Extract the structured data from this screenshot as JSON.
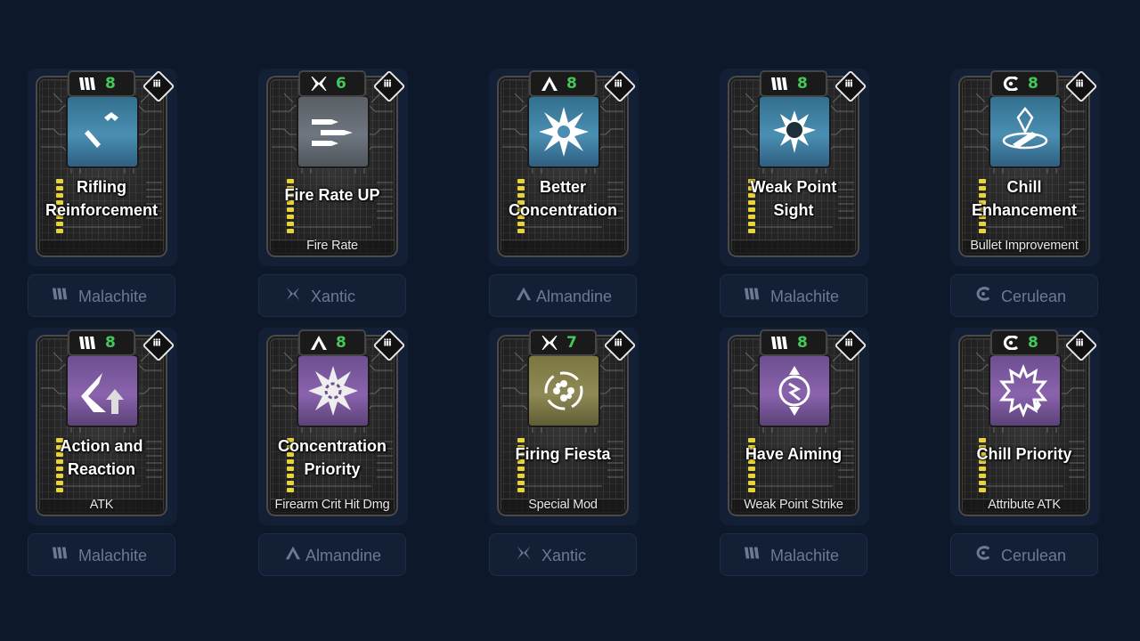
{
  "cards": [
    {
      "cost": "8",
      "family_icon": "malachite-icon",
      "art": "blue",
      "art_icon": "rifling-icon",
      "name": [
        "Rifling",
        "Reinforcement"
      ],
      "subtitle": "",
      "tag": "Malachite"
    },
    {
      "cost": "6",
      "family_icon": "xantic-icon",
      "art": "gray",
      "art_icon": "bullets-icon",
      "name": [
        "Fire Rate UP"
      ],
      "subtitle": "Fire Rate",
      "tag": "Xantic"
    },
    {
      "cost": "8",
      "family_icon": "almandine-icon",
      "art": "blue",
      "art_icon": "burst-star-icon",
      "name": [
        "Better",
        "Concentration"
      ],
      "subtitle": "",
      "tag": "Almandine"
    },
    {
      "cost": "8",
      "family_icon": "malachite-icon",
      "art": "blue",
      "art_icon": "weak-point-icon",
      "name": [
        "Weak Point",
        "Sight"
      ],
      "subtitle": "",
      "tag": "Malachite"
    },
    {
      "cost": "8",
      "family_icon": "cerulean-icon",
      "art": "blue",
      "art_icon": "chill-bullet-icon",
      "name": [
        "Chill",
        "Enhancement"
      ],
      "subtitle": "Bullet Improvement",
      "tag": "Cerulean"
    },
    {
      "cost": "8",
      "family_icon": "malachite-icon",
      "art": "purple",
      "art_icon": "arrow-up-icon",
      "name": [
        "Action and",
        "Reaction"
      ],
      "subtitle": "ATK",
      "tag": "Malachite"
    },
    {
      "cost": "8",
      "family_icon": "almandine-icon",
      "art": "purple",
      "art_icon": "crit-star-icon",
      "name": [
        "Concentration",
        "Priority"
      ],
      "subtitle": "Firearm Crit Hit Dmg",
      "tag": "Almandine"
    },
    {
      "cost": "7",
      "family_icon": "xantic-icon",
      "art": "gold",
      "art_icon": "revolver-cylinder-icon",
      "name": [
        "Firing Fiesta"
      ],
      "subtitle": "Special Mod",
      "tag": "Xantic"
    },
    {
      "cost": "8",
      "family_icon": "malachite-icon",
      "art": "purple",
      "art_icon": "aiming-icon",
      "name": [
        "Have Aiming"
      ],
      "subtitle": "Weak Point Strike",
      "tag": "Malachite"
    },
    {
      "cost": "8",
      "family_icon": "cerulean-icon",
      "art": "purple",
      "art_icon": "chill-burst-icon",
      "name": [
        "Chill Priority"
      ],
      "subtitle": "Attribute ATK",
      "tag": "Cerulean"
    }
  ],
  "colors": {
    "background": "#0e182b",
    "cost_number": "#44c85a",
    "pin_yellow": "#e8d33a",
    "tag_text": "#6b7a92"
  },
  "corner_icon": "module-grid-icon"
}
